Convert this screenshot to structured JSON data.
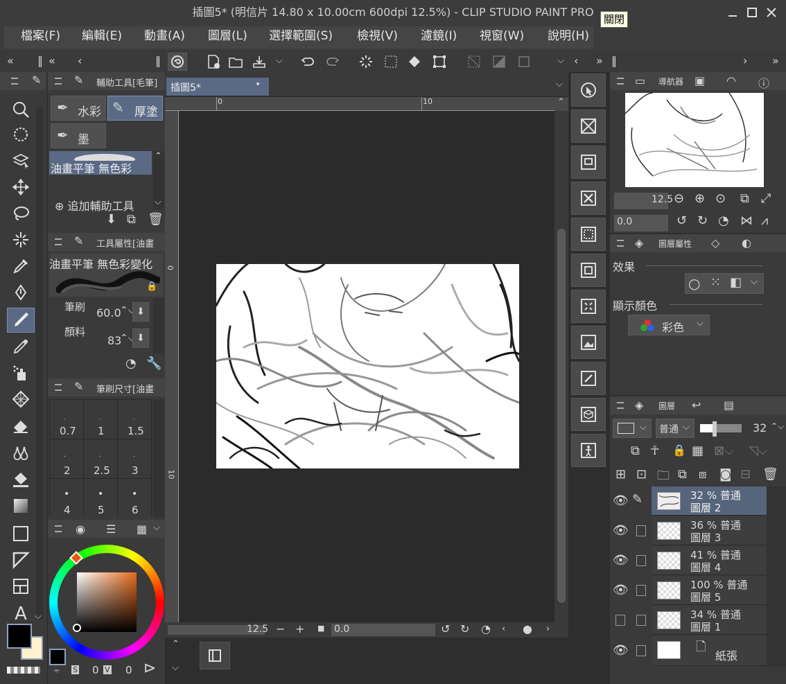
{
  "window": {
    "title": "插圖5* (明信片 14.80 x 10.00cm 600dpi 12.5%)  - CLIP STUDIO PAINT PRO",
    "close_tooltip": "關閉"
  },
  "menu": [
    "檔案(F)",
    "編輯(E)",
    "動畫(A)",
    "圖層(L)",
    "選擇範圍(S)",
    "檢視(V)",
    "濾鏡(I)",
    "視窗(W)",
    "說明(H)"
  ],
  "subtool": {
    "title": "輔助工具[毛筆]",
    "tabs": [
      "水彩",
      "厚塗",
      "墨"
    ],
    "selected": "油畫平筆 無色彩",
    "add": "追加輔助工具"
  },
  "toolprop": {
    "title": "工具屬性[油畫",
    "preset": "油畫平筆 無色彩變化",
    "size_label": "筆刷",
    "size_value": "60.0",
    "density_label": "顏料",
    "density_value": "83"
  },
  "brushsize": {
    "title": "筆刷尺寸[油畫",
    "sizes": [
      "0.7",
      "1",
      "1.5",
      "2",
      "2.5",
      "3",
      "4",
      "5",
      "6"
    ]
  },
  "color": {
    "s_label": "S",
    "s_value": "0",
    "v_label": "V",
    "v_value": "0",
    "main": "#000000",
    "sub": "#fff2cc"
  },
  "doc_tab": "插圖5*",
  "ruler": {
    "h0": "0",
    "h10": "10",
    "v0": "0",
    "v10": "10"
  },
  "canvas_status": {
    "zoom": "12.5",
    "rotate": "0.0"
  },
  "navigator": {
    "title": "導航器",
    "zoom": "12.5",
    "rotate": "0.0"
  },
  "layer_prop": {
    "title": "圖層屬性",
    "effect": "效果",
    "display_color": "顯示顏色",
    "color_mode": "彩色"
  },
  "layers_panel": {
    "title": "圖層",
    "blend": "普通",
    "opacity": "32"
  },
  "layers": [
    {
      "opacity": "32 % 普通",
      "name": "圖層 2",
      "visible": true,
      "selected": true
    },
    {
      "opacity": "36 % 普通",
      "name": "圖層 3",
      "visible": true,
      "selected": false
    },
    {
      "opacity": "41 % 普通",
      "name": "圖層 4",
      "visible": true,
      "selected": false
    },
    {
      "opacity": "100 % 普通",
      "name": "圖層 5",
      "visible": true,
      "selected": false
    },
    {
      "opacity": "34 % 普通",
      "name": "圖層 1",
      "visible": false,
      "selected": false
    }
  ],
  "paper_layer": "紙張"
}
